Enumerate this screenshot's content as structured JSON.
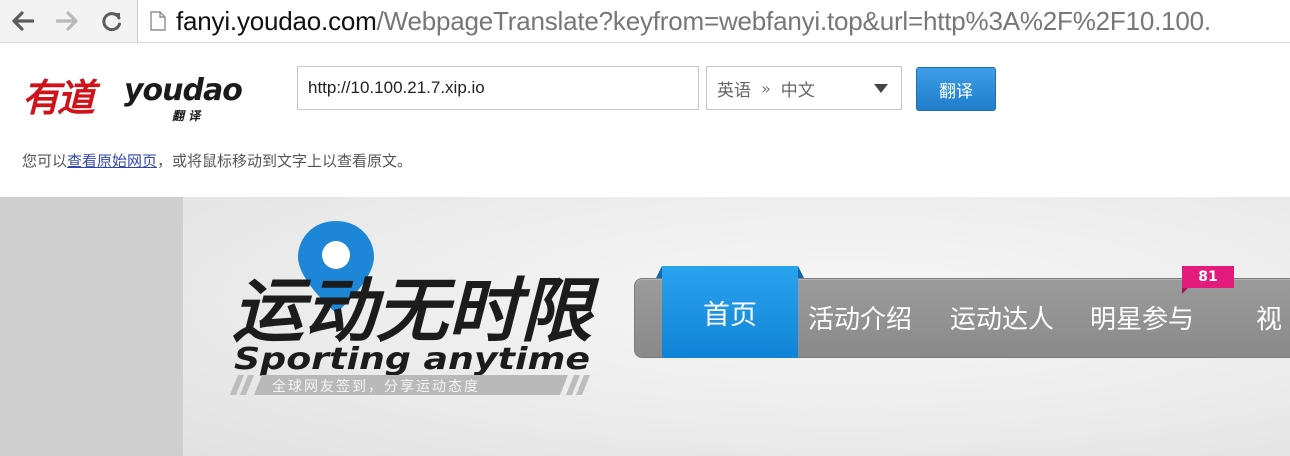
{
  "browser": {
    "url_domain": "fanyi.youdao.com",
    "url_rest": "/WebpageTranslate?keyfrom=webfanyi.top&url=http%3A%2F%2F10.100."
  },
  "youdao": {
    "logo_cn": "有道",
    "logo_en": "youdao",
    "logo_sub": "翻 译",
    "url_value": "http://10.100.21.7.xip.io",
    "lang_from": "英语",
    "lang_arrow": "»",
    "lang_to": "中文",
    "translate_label": "翻译",
    "tip_prefix": "您可以",
    "tip_link": "查看原始网页",
    "tip_suffix": "，或将鼠标移动到文字上以查看原文。"
  },
  "site": {
    "logo_title": "运动无时限",
    "logo_en": "Sporting anytime",
    "logo_slogan": "全球网友签到，分享运动态度",
    "nav": [
      "首页",
      "活动介绍",
      "运动达人",
      "明星参与",
      "视"
    ],
    "badge": "81"
  },
  "colors": {
    "youdao_red": "#d0121b",
    "button_blue": "#1f7dcb",
    "nav_active": "#1183d6",
    "badge_pink": "#e31b7c"
  }
}
